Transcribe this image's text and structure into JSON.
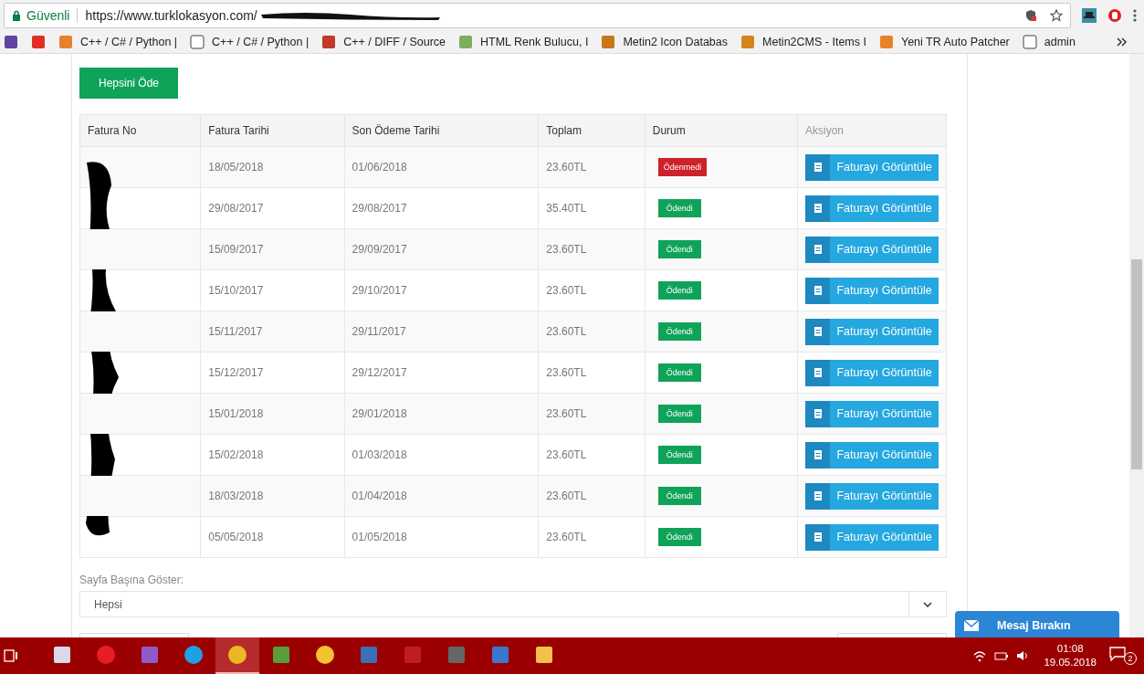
{
  "browser": {
    "security_label": "Güvenli",
    "url": "https://www.turklokasyon.com/"
  },
  "bookmarks": [
    {
      "kind": "twitch"
    },
    {
      "kind": "youtube"
    },
    {
      "kind": "orange",
      "label": "C++ / C# / Python |"
    },
    {
      "kind": "page",
      "label": "C++ / C# / Python |"
    },
    {
      "kind": "gear",
      "label": "C++ / DIFF / Source"
    },
    {
      "kind": "figure",
      "label": "HTML Renk Bulucu, I"
    },
    {
      "kind": "sword",
      "label": "Metin2 Icon Databas"
    },
    {
      "kind": "m2",
      "label": "Metin2CMS - Items I"
    },
    {
      "kind": "orange",
      "label": "Yeni TR Auto Patcher"
    },
    {
      "kind": "page",
      "label": "admin"
    }
  ],
  "pay_all_button": "Hepsini Öde",
  "table": {
    "columns": [
      "Fatura No",
      "Fatura Tarihi",
      "Son Ödeme Tarihi",
      "Toplam",
      "Durum",
      "Aksiyon"
    ],
    "rows": [
      {
        "date": "18/05/2018",
        "due": "01/06/2018",
        "total": "23.60TL",
        "status": "Ödenmedi",
        "paid": false,
        "action": "Faturayı Görüntüle"
      },
      {
        "date": "29/08/2017",
        "due": "29/08/2017",
        "total": "35.40TL",
        "status": "Ödendi",
        "paid": true,
        "action": "Faturayı Görüntüle"
      },
      {
        "date": "15/09/2017",
        "due": "29/09/2017",
        "total": "23.60TL",
        "status": "Ödendi",
        "paid": true,
        "action": "Faturayı Görüntüle"
      },
      {
        "date": "15/10/2017",
        "due": "29/10/2017",
        "total": "23.60TL",
        "status": "Ödendi",
        "paid": true,
        "action": "Faturayı Görüntüle"
      },
      {
        "date": "15/11/2017",
        "due": "29/11/2017",
        "total": "23.60TL",
        "status": "Ödendi",
        "paid": true,
        "action": "Faturayı Görüntüle"
      },
      {
        "date": "15/12/2017",
        "due": "29/12/2017",
        "total": "23.60TL",
        "status": "Ödendi",
        "paid": true,
        "action": "Faturayı Görüntüle"
      },
      {
        "date": "15/01/2018",
        "due": "29/01/2018",
        "total": "23.60TL",
        "status": "Ödendi",
        "paid": true,
        "action": "Faturayı Görüntüle"
      },
      {
        "date": "15/02/2018",
        "due": "01/03/2018",
        "total": "23.60TL",
        "status": "Ödendi",
        "paid": true,
        "action": "Faturayı Görüntüle"
      },
      {
        "date": "18/03/2018",
        "due": "01/04/2018",
        "total": "23.60TL",
        "status": "Ödendi",
        "paid": true,
        "action": "Faturayı Görüntüle"
      },
      {
        "date": "05/05/2018",
        "due": "01/05/2018",
        "total": "23.60TL",
        "status": "Ödendi",
        "paid": true,
        "action": "Faturayı Görüntüle"
      }
    ]
  },
  "per_page": {
    "label": "Sayfa Başına Göster:",
    "value": "Hepsi"
  },
  "chat_button": "Mesaj Bırakın",
  "taskbar": {
    "apps": [
      {
        "kind": "paint",
        "selected": false
      },
      {
        "kind": "opera",
        "selected": false
      },
      {
        "kind": "vs",
        "selected": false
      },
      {
        "kind": "skype",
        "selected": false
      },
      {
        "kind": "chrome",
        "selected": true
      },
      {
        "kind": "notepad",
        "selected": false
      },
      {
        "kind": "yellow",
        "selected": false
      },
      {
        "kind": "box",
        "selected": false
      },
      {
        "kind": "filezilla",
        "selected": false
      },
      {
        "kind": "lock",
        "selected": false
      },
      {
        "kind": "network",
        "selected": false
      },
      {
        "kind": "folder",
        "selected": false
      }
    ],
    "time": "01:08",
    "date": "19.05.2018",
    "notifications": "2"
  }
}
